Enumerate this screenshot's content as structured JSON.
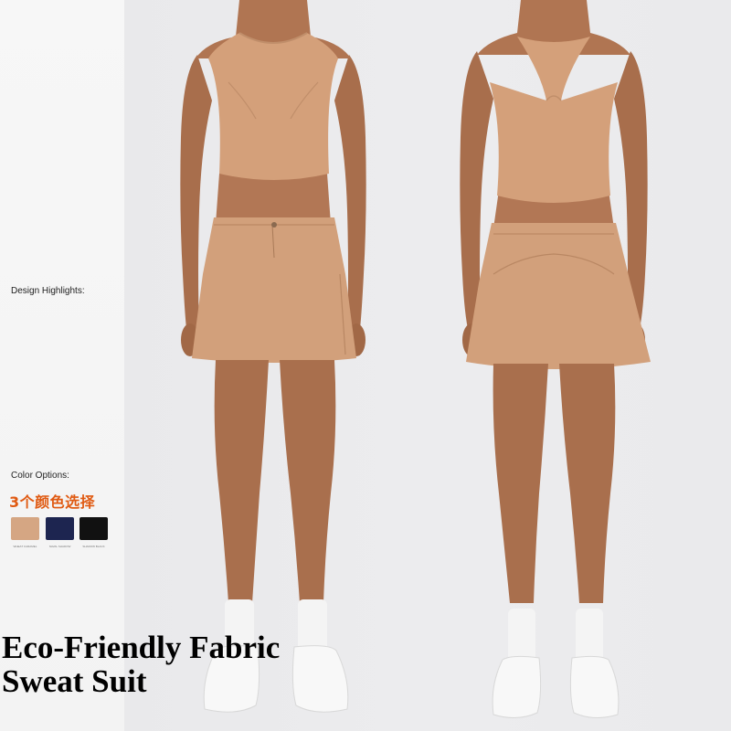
{
  "panel": {
    "design_label": "Design Highlights:",
    "color_label": "Color Options:",
    "color_count_cn": "3个颜色选择"
  },
  "swatches": [
    {
      "color": "#d5a683",
      "caption": "WHEAT CARAMEL"
    },
    {
      "color": "#1d2550",
      "caption": "NAVAL SHADOW"
    },
    {
      "color": "#111111",
      "caption": "SHADOW BLACK"
    }
  ],
  "headline": {
    "line1": "Eco-Friendly Fabric",
    "line2": "Sweat Suit"
  },
  "colors": {
    "fabric": "#d4a27d",
    "skin": "#b07552",
    "background": "#ebebed",
    "accent_cn": "#e05a12"
  }
}
